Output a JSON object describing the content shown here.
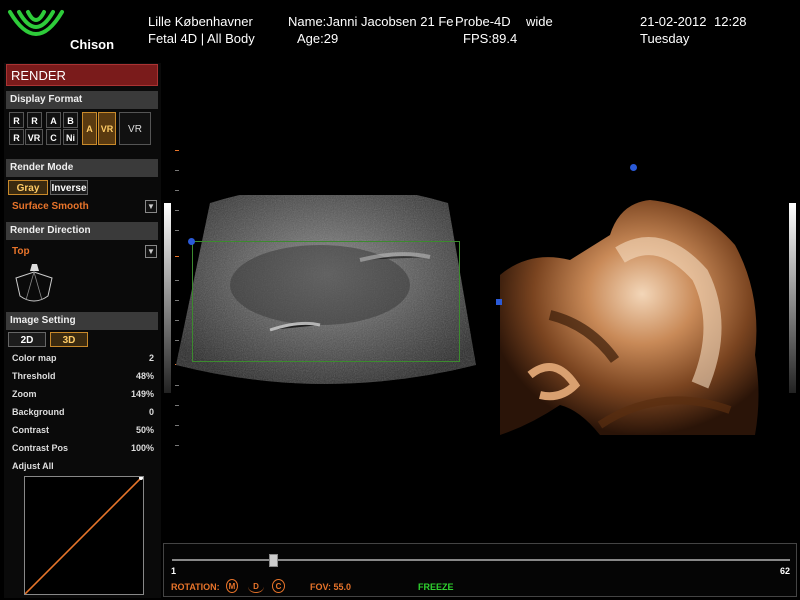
{
  "header": {
    "brand": "Chison",
    "location": "Lille Københavner",
    "exam": "Fetal 4D | All Body",
    "patient_name": "Name:Janni Jacobsen 21 Fe",
    "age": "Age:29",
    "probe": "Probe-4D",
    "probe_mode": "wide",
    "fps": "FPS:89.4",
    "date": "21-02-2012",
    "time": "12:28",
    "weekday": "Tuesday"
  },
  "panel": {
    "title": "RENDER",
    "display_format": {
      "label": "Display Format",
      "row1": [
        "R",
        "R",
        "A",
        "B"
      ],
      "row2": [
        "R",
        "VR",
        "C",
        "Ni"
      ],
      "active_a": "A",
      "active_vr": "VR",
      "vr": "VR"
    },
    "render_mode": {
      "label": "Render Mode",
      "gray": "Gray",
      "inverse": "Inverse",
      "mode_value": "Surface Smooth"
    },
    "render_direction": {
      "label": "Render Direction",
      "value": "Top"
    },
    "image_setting": {
      "label": "Image Setting",
      "btn_2d": "2D",
      "btn_3d": "3D",
      "rows": [
        {
          "label": "Color map",
          "value": "2"
        },
        {
          "label": "Threshold",
          "value": "48%"
        },
        {
          "label": "Zoom",
          "value": "149%"
        },
        {
          "label": "Background",
          "value": "0"
        },
        {
          "label": "Contrast",
          "value": "50%"
        },
        {
          "label": "Contrast Pos",
          "value": "100%"
        }
      ],
      "adjust_all": "Adjust All"
    }
  },
  "bottom": {
    "slider_min": "1",
    "slider_max": "62",
    "slider_value": 9,
    "rotation_label": "ROTATION:",
    "rot_m": "M",
    "rot_d": "D",
    "rot_c": "C",
    "fov": "FOV: 55.0",
    "freeze": "FREEZE"
  },
  "colors": {
    "accent_orange": "#e8742a",
    "freeze_green": "#2fd32f",
    "render_header": "#7a1b1b",
    "logo_green": "#2ecc3a"
  },
  "icons": {
    "logo": "chison-logo-icon",
    "probe": "probe-sector-icon",
    "dropdown": "dropdown-arrow-icon"
  }
}
